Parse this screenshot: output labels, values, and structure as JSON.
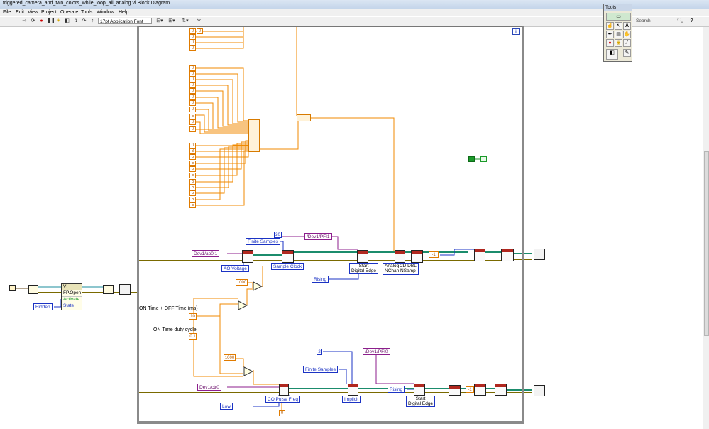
{
  "window": {
    "title": "triggered_camera_and_two_colors_while_loop_all_analog.vi Block Diagram"
  },
  "menu": [
    "File",
    "Edit",
    "View",
    "Project",
    "Operate",
    "Tools",
    "Window",
    "Help"
  ],
  "toolbar": {
    "font": "17pt Application Font",
    "search_placeholder": "Search",
    "help_label": "?"
  },
  "tools_palette": {
    "title": "Tools"
  },
  "constants": {
    "top_zeros": [
      "0",
      "0",
      "0",
      "0",
      "0"
    ],
    "mid_zeros": [
      "0",
      "0",
      "0",
      "0",
      "0",
      "0",
      "0",
      "0",
      "0",
      "0"
    ],
    "fives": [
      "0",
      "3",
      "5",
      "5",
      "5",
      "5",
      "5",
      "5",
      "5",
      "5",
      "5",
      "5"
    ],
    "samples_20": "20",
    "minus_one_a": "-1",
    "minus_one_b": "-1",
    "thousand_a": "1000",
    "thousand_b": "1000",
    "on_off_value": "10",
    "duty_value": "0.1",
    "two": "2",
    "zero_bottom": "0",
    "iteration": "i"
  },
  "channels": {
    "ao": "Dev1/ao0:1",
    "ctr": "Dev1/ctr0",
    "pfi_top": "/Dev1/PFI1",
    "pfi_bottom": "/Dev1/PFI0"
  },
  "rings": {
    "finite_top": "Finite Samples",
    "finite_bottom": "Finite Samples",
    "ao_voltage": "AO Voltage",
    "sample_clock": "Sample Clock",
    "rising_top": "Rising",
    "rising_bottom": "Rising",
    "hidden": "Hidden",
    "low": "Low",
    "co_pulse": "CO Pulse Freq",
    "implicit": "Implicit"
  },
  "node_labels": {
    "start_digital_edge_top": [
      "Start",
      "Digital Edge"
    ],
    "start_digital_edge_bottom": [
      "Start",
      "Digital Edge"
    ],
    "analog_write": [
      "Analog 2D DBL",
      "NChan NSamp"
    ]
  },
  "labels": {
    "on_off_time": "ON Time + OFF Time (ms)",
    "on_duty": "ON Time duty cycle"
  },
  "property_node": {
    "header": "VI",
    "rows": [
      "FP.Open",
      "Activate",
      "State"
    ]
  },
  "colors": {
    "orange_wire": "#f08a00",
    "blue_wire": "#1b33c4",
    "purple_wire": "#8c1e8c",
    "error_wire": "#7a6a00",
    "green": "#1a9a2a"
  }
}
